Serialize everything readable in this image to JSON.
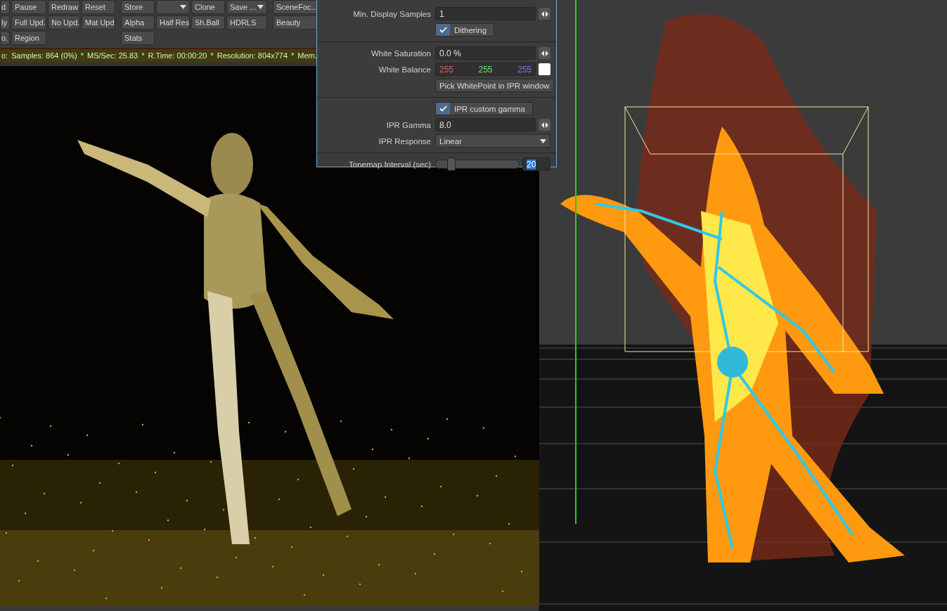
{
  "toolbar": {
    "rows": [
      [
        {
          "kind": "button",
          "label": "d"
        },
        {
          "kind": "button",
          "label": "Pause"
        },
        {
          "kind": "button",
          "label": "Redraw"
        },
        {
          "kind": "button",
          "label": "Reset"
        },
        {
          "kind": "gap"
        },
        {
          "kind": "button",
          "label": "Store"
        },
        {
          "kind": "dropdown"
        },
        {
          "kind": "button",
          "label": "Clone"
        },
        {
          "kind": "dropdown",
          "label": "Save ..."
        },
        {
          "kind": "gap"
        },
        {
          "kind": "button",
          "label": "SceneFoc..."
        }
      ],
      [
        {
          "kind": "button",
          "label": "ly"
        },
        {
          "kind": "button",
          "label": "Full Upd."
        },
        {
          "kind": "button",
          "label": "No Upd."
        },
        {
          "kind": "button",
          "label": "Mat Upd"
        },
        {
          "kind": "gap"
        },
        {
          "kind": "button",
          "label": "Alpha"
        },
        {
          "kind": "button",
          "label": "Half Res"
        },
        {
          "kind": "button",
          "label": "Sh.Ball"
        },
        {
          "kind": "button",
          "label": "HDRLS"
        },
        {
          "kind": "gap"
        },
        {
          "kind": "button",
          "label": "Beauty"
        }
      ],
      [
        {
          "kind": "button",
          "label": "o."
        },
        {
          "kind": "button",
          "label": "Region"
        },
        {
          "kind": "spacer"
        },
        {
          "kind": "spacer"
        },
        {
          "kind": "gap"
        },
        {
          "kind": "button",
          "label": "Stats"
        }
      ]
    ]
  },
  "status_bar": [
    "o:",
    "Samples: 864 (0%)",
    "*",
    "MS/Sec: 25.83",
    "*",
    "R.Time: 00:00:20",
    "*",
    "Resolution: 804x774",
    "*",
    "Mem."
  ],
  "panel": {
    "sections": [
      [
        {
          "kind": "number",
          "label": "Min. Display Samples",
          "value": "1"
        },
        {
          "kind": "checkbox",
          "label": "Dithering",
          "checked": true
        }
      ],
      [
        {
          "kind": "number",
          "label": "White Saturation",
          "value": "0.0 %"
        },
        {
          "kind": "color",
          "label": "White Balance",
          "values": [
            {
              "text": "255",
              "color": "#e85a5a"
            },
            {
              "text": "255",
              "color": "#6ee26e"
            },
            {
              "text": "255",
              "color": "#7a7ae8"
            }
          ],
          "color": "#ffffff"
        },
        {
          "kind": "button",
          "label": "Pick WhitePoint in IPR window"
        }
      ],
      [
        {
          "kind": "checkbox",
          "label": "IPR custom gamma",
          "checked": true
        },
        {
          "kind": "number",
          "label": "IPR Gamma",
          "value": "8.0"
        },
        {
          "kind": "dropdown",
          "label": "IPR Response",
          "value": "Linear"
        }
      ],
      [
        {
          "kind": "slider",
          "label": "Tonemap Interval (sec)",
          "level": 0.18,
          "value": "20"
        }
      ]
    ]
  }
}
